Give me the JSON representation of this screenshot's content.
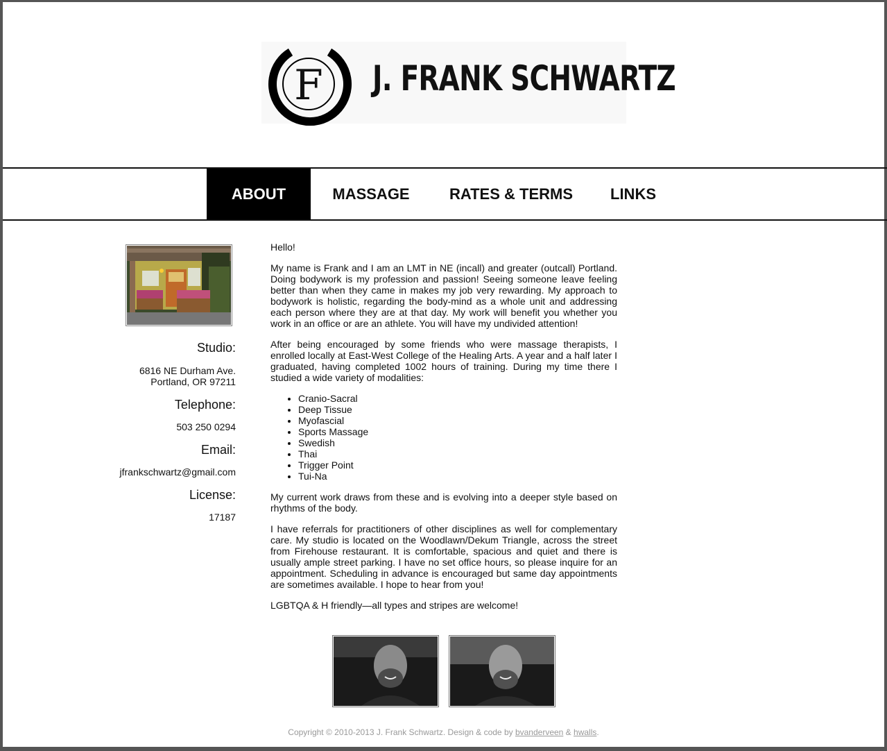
{
  "header": {
    "logo_letter": "F",
    "site_title": "J. FRANK SCHWARTZ"
  },
  "nav": {
    "items": [
      {
        "label": "ABOUT",
        "active": true
      },
      {
        "label": "MASSAGE",
        "active": false
      },
      {
        "label": "RATES & TERMS",
        "active": false
      },
      {
        "label": "LINKS",
        "active": false
      }
    ]
  },
  "sidebar": {
    "studio_heading": "Studio:",
    "studio_address_line1": "6816 NE Durham Ave.",
    "studio_address_line2": "Portland, OR 97211",
    "telephone_heading": "Telephone:",
    "telephone": "503 250 0294",
    "email_heading": "Email:",
    "email": "jfrankschwartz@gmail.com",
    "license_heading": "License:",
    "license": "17187"
  },
  "main": {
    "greeting": "Hello!",
    "para1": "My name is Frank and I am an LMT in NE (incall) and greater (outcall) Portland. Doing bodywork is my profession and passion! Seeing someone leave feeling better than when they came in makes my job very rewarding. My approach to bodywork is holistic, regarding the body-mind as a whole unit and addressing each person where they are at that day. My work will benefit you whether you work in an office or are an athlete. You will have my undivided attention!",
    "para2": "After being encouraged by some friends who were massage therapists, I enrolled locally at East-West College of the Healing Arts. A year and a half later I graduated, having completed 1002 hours of training. During my time there I studied a wide variety of modalities:",
    "modalities": [
      "Cranio-Sacral",
      "Deep Tissue",
      "Myofascial",
      "Sports Massage",
      "Swedish",
      "Thai",
      "Trigger Point",
      "Tui-Na"
    ],
    "para3": "My current work draws from these and is evolving into a deeper style based on rhythms of the body.",
    "para4": "I have referrals for practitioners of other disciplines as well for complementary care. My studio is located on the Woodlawn/Dekum Triangle, across the street from Firehouse restaurant. It is comfortable, spacious and quiet and there is usually ample street parking. I have no set office hours, so please inquire for an appointment. Scheduling in advance is encouraged but same day appointments are sometimes available. I hope to hear from you!",
    "para5": "LGBTQA & H friendly—all types and stripes are welcome!"
  },
  "footer": {
    "copyright": "Copyright © 2010-2013 J. Frank Schwartz. Design & code by ",
    "link1": "bvanderveen",
    "sep": " & ",
    "link2": "hwalls",
    "end": "."
  }
}
